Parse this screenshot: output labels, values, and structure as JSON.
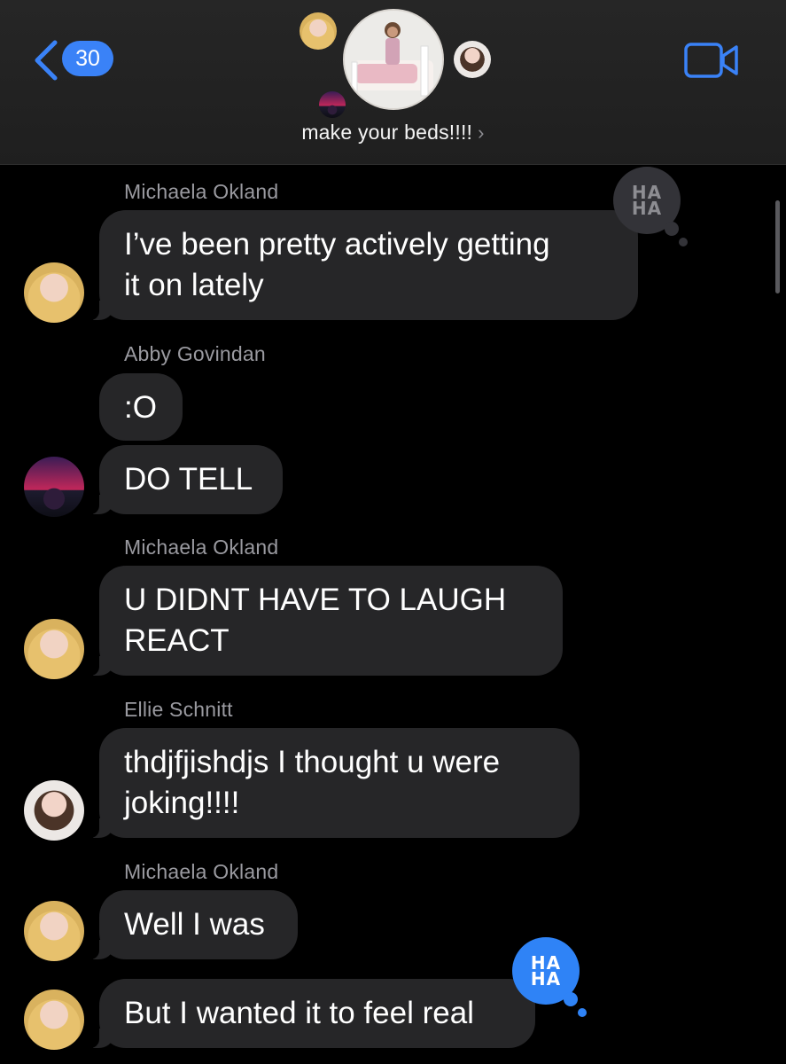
{
  "header": {
    "back_count": "30",
    "group_name": "make your beds!!!!",
    "chevron": "›",
    "icons": {
      "back": "chevron-left-icon",
      "video": "video-camera-icon",
      "group_name_chevron": "chevron-right-icon"
    },
    "accent_color": "#3a82f7"
  },
  "messages": [
    {
      "sender": "Michaela Okland",
      "text": "I’ve been pretty actively getting\nit on lately",
      "reaction": "HA\nHA"
    },
    {
      "sender": "Abby Govindan",
      "text": ":O"
    },
    {
      "text": "DO TELL"
    },
    {
      "sender": "Michaela Okland",
      "text": "U DIDNT HAVE TO LAUGH\nREACT"
    },
    {
      "sender": "Ellie Schnitt",
      "text": "thdjfjishdjs I thought u were\njoking!!!!"
    },
    {
      "sender": "Michaela Okland",
      "text": "Well I was"
    },
    {
      "text": "But I wanted it to feel real",
      "reaction": "HA\nHA"
    }
  ]
}
